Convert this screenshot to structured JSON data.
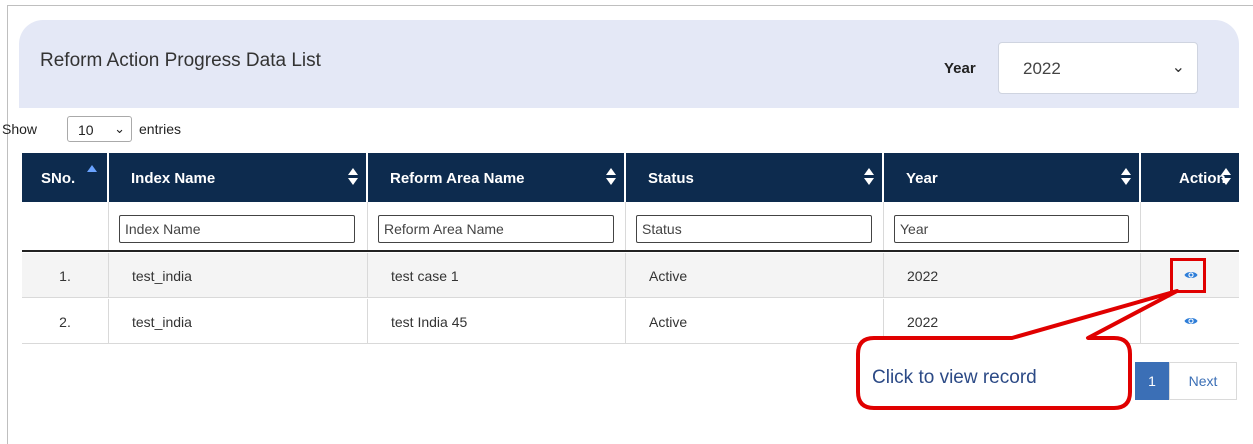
{
  "panel": {
    "title": "Reform Action Progress Data List",
    "year_label": "Year",
    "year_value": "2022"
  },
  "length_menu": {
    "show_label": "Show",
    "value": "10",
    "entries_label": "entries"
  },
  "table": {
    "headers": {
      "sno": "SNo.",
      "index_name": "Index Name",
      "reform_area": "Reform Area Name",
      "status": "Status",
      "year": "Year",
      "action": "Action"
    },
    "filters": {
      "index_name": "Index Name",
      "reform_area": "Reform Area Name",
      "status": "Status",
      "year": "Year"
    },
    "rows": [
      {
        "sno": "1.",
        "index_name": "test_india",
        "reform_area": "test case 1",
        "status": "Active",
        "year": "2022",
        "action_icon": "eye-icon"
      },
      {
        "sno": "2.",
        "index_name": "test_india",
        "reform_area": "test India 45",
        "status": "Active",
        "year": "2022",
        "action_icon": "eye-icon"
      }
    ]
  },
  "callout": {
    "text": "Click to view  record"
  },
  "pagination": {
    "current_page": "1",
    "next_label": "Next"
  },
  "colors": {
    "header_bg": "#0d2b4e",
    "panel_bg": "#e4e8f6",
    "accent_blue": "#3b6fb6",
    "callout_red": "#e00000"
  }
}
